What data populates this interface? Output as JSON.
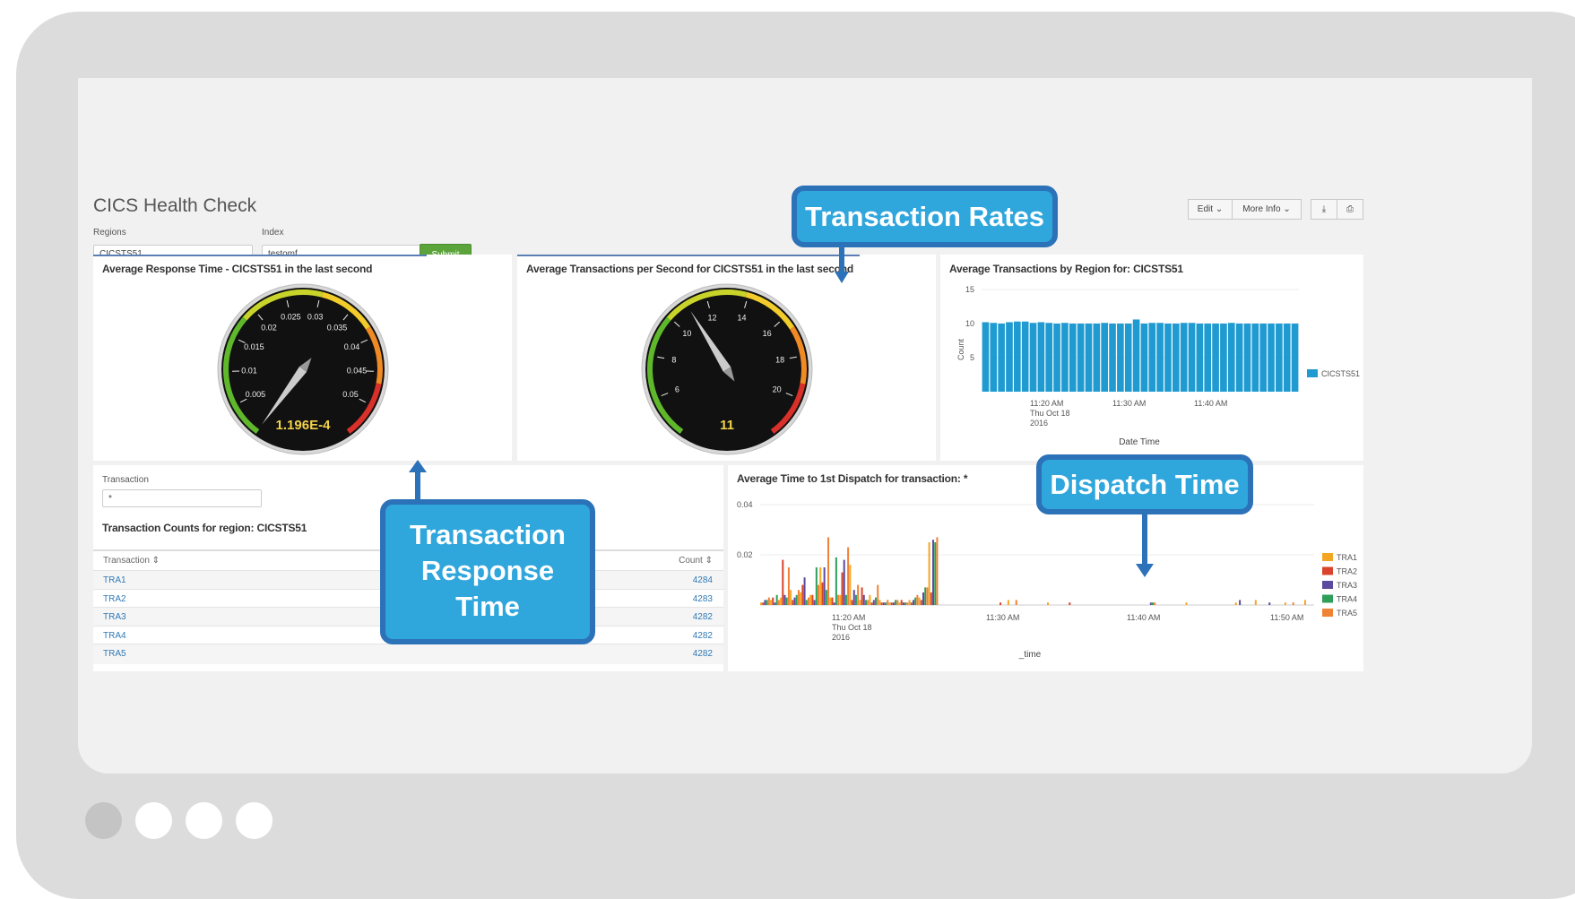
{
  "dashboard": {
    "title": "CICS Health Check",
    "regions_label": "Regions",
    "regions_value": "CICSTS51",
    "index_label": "Index",
    "index_value": "testomf",
    "submit_label": "Submit",
    "edit_label": "Edit",
    "more_info_label": "More Info"
  },
  "panels": {
    "response_time": {
      "title": "Average Response Time - CICSTS51 in the last second",
      "ticks": [
        "0.005",
        "0.01",
        "0.015",
        "0.02",
        "0.025",
        "0.03",
        "0.035",
        "0.04",
        "0.045",
        "0.05"
      ],
      "value_text": "1.196E-4"
    },
    "tps": {
      "title": "Average Transactions per Second for CICSTS51 in the last second",
      "ticks": [
        "6",
        "8",
        "10",
        "12",
        "14",
        "16",
        "18",
        "20"
      ],
      "value_text": "11"
    },
    "by_region": {
      "title": "Average Transactions by Region for: CICSTS51",
      "y_ticks": [
        "15",
        "10",
        "5"
      ],
      "x_ticks": [
        "11:20 AM",
        "11:30 AM",
        "11:40 AM"
      ],
      "x_date_line1": "Thu Oct 18",
      "x_date_line2": "2016",
      "ylabel": "Count",
      "xlabel": "Date Time",
      "legend": "CICSTS51"
    },
    "filter": {
      "label": "Transaction",
      "value": "*"
    },
    "counts": {
      "title": "Transaction Counts for region: CICSTS51",
      "col_transaction": "Transaction",
      "col_count": "Count",
      "rows": [
        {
          "name": "TRA1",
          "count": "4284"
        },
        {
          "name": "TRA2",
          "count": "4283"
        },
        {
          "name": "TRA3",
          "count": "4282"
        },
        {
          "name": "TRA4",
          "count": "4282"
        },
        {
          "name": "TRA5",
          "count": "4282"
        }
      ]
    },
    "dispatch": {
      "title": "Average Time to 1st Dispatch for transaction: *",
      "y_ticks": [
        "0.04",
        "0.02"
      ],
      "x_ticks": [
        "11:20 AM",
        "11:30 AM",
        "11:40 AM",
        "11:50 AM"
      ],
      "x_date_line1": "Thu Oct 18",
      "x_date_line2": "2016",
      "xlabel": "_time",
      "legend": [
        "TRA1",
        "TRA2",
        "TRA3",
        "TRA4",
        "TRA5"
      ]
    }
  },
  "callouts": {
    "rates": "Transaction Rates",
    "response_line1": "Transaction",
    "response_line2": "Response",
    "response_line3": "Time",
    "dispatch": "Dispatch Time"
  },
  "colors": {
    "accent_blue": "#2fa6dc",
    "bar_blue": "#1f9bd1",
    "submit_green": "#5ba33b",
    "series": [
      "#f4a623",
      "#d9442b",
      "#5c4a9e",
      "#2e9e5a",
      "#f08234"
    ]
  },
  "chart_data": [
    {
      "type": "gauge",
      "title": "Average Response Time - CICSTS51 in the last second",
      "range": [
        0,
        0.055
      ],
      "value": 0.0001196
    },
    {
      "type": "gauge",
      "title": "Average Transactions per Second for CICSTS51 in the last second",
      "range": [
        4,
        22
      ],
      "value": 11
    },
    {
      "type": "bar",
      "title": "Average Transactions by Region for: CICSTS51",
      "xlabel": "Date Time",
      "ylabel": "Count",
      "ylim": [
        0,
        15
      ],
      "series": [
        {
          "name": "CICSTS51",
          "values": [
            10.2,
            10.1,
            10,
            10.2,
            10.3,
            10.3,
            10.1,
            10.2,
            10.1,
            10,
            10.1,
            10,
            10,
            10,
            10,
            10.1,
            10,
            10,
            10,
            10.6,
            10,
            10.1,
            10.1,
            10,
            10,
            10.1,
            10.1,
            10,
            10,
            10,
            10,
            10.1,
            10,
            10,
            10,
            10,
            10,
            10,
            10,
            10
          ]
        }
      ]
    },
    {
      "type": "bar",
      "title": "Average Time to 1st Dispatch for transaction: *",
      "xlabel": "_time",
      "ylim": [
        0,
        0.045
      ],
      "series": [
        {
          "name": "TRA1",
          "values": [
            0.001,
            0.002,
            0.003,
            0.006,
            0.005,
            0.004,
            0.015,
            0.003,
            0.004,
            0.016,
            0.002,
            0.004,
            0.002,
            0.001,
            0.001,
            0.002,
            0.003,
            0.025,
            0,
            0,
            0,
            0,
            0,
            0,
            0,
            0.002,
            0,
            0,
            0,
            0.001,
            0,
            0,
            0,
            0,
            0,
            0,
            0,
            0,
            0,
            0,
            0,
            0,
            0,
            0.001,
            0,
            0,
            0,
            0,
            0.001,
            0,
            0.002,
            0,
            0,
            0.001,
            0,
            0.002
          ]
        },
        {
          "name": "TRA2",
          "values": [
            0.001,
            0.003,
            0.018,
            0.002,
            0.008,
            0.004,
            0.009,
            0.003,
            0.013,
            0.002,
            0.007,
            0.001,
            0.001,
            0.001,
            0.002,
            0.001,
            0.002,
            0.005,
            0,
            0,
            0,
            0,
            0,
            0,
            0.001,
            0,
            0,
            0,
            0,
            0,
            0,
            0.001,
            0,
            0,
            0,
            0,
            0,
            0,
            0,
            0,
            0,
            0,
            0,
            0,
            0,
            0,
            0,
            0,
            0,
            0,
            0,
            0,
            0,
            0,
            0,
            0
          ]
        },
        {
          "name": "TRA3",
          "values": [
            0.002,
            0.001,
            0.004,
            0.003,
            0.011,
            0.002,
            0.015,
            0.001,
            0.018,
            0.006,
            0.004,
            0.002,
            0.001,
            0.001,
            0.001,
            0.002,
            0.005,
            0.026,
            0,
            0,
            0,
            0,
            0,
            0,
            0,
            0,
            0,
            0,
            0,
            0,
            0,
            0,
            0,
            0,
            0,
            0,
            0,
            0,
            0,
            0.001,
            0,
            0,
            0,
            0,
            0,
            0,
            0,
            0,
            0.002,
            0,
            0,
            0.001,
            0,
            0,
            0,
            0
          ]
        },
        {
          "name": "TRA4",
          "values": [
            0.002,
            0.004,
            0.003,
            0.004,
            0.002,
            0.015,
            0.006,
            0.019,
            0.004,
            0.004,
            0.002,
            0.003,
            0.001,
            0.002,
            0.001,
            0.003,
            0.007,
            0.025,
            0,
            0,
            0,
            0,
            0,
            0,
            0,
            0,
            0,
            0,
            0,
            0,
            0,
            0,
            0,
            0,
            0,
            0,
            0,
            0,
            0,
            0.001,
            0,
            0,
            0,
            0,
            0,
            0,
            0,
            0,
            0,
            0,
            0,
            0,
            0,
            0,
            0,
            0
          ]
        },
        {
          "name": "TRA5",
          "values": [
            0.003,
            0.002,
            0.015,
            0.006,
            0.003,
            0.008,
            0.027,
            0.004,
            0.023,
            0.008,
            0.002,
            0.008,
            0.002,
            0.002,
            0.001,
            0.004,
            0.007,
            0.027,
            0,
            0,
            0,
            0,
            0,
            0,
            0,
            0.002,
            0,
            0,
            0,
            0,
            0,
            0,
            0,
            0,
            0,
            0,
            0,
            0,
            0,
            0.001,
            0,
            0,
            0,
            0,
            0,
            0,
            0,
            0,
            0,
            0,
            0,
            0,
            0,
            0.001,
            0,
            0
          ]
        }
      ]
    }
  ]
}
